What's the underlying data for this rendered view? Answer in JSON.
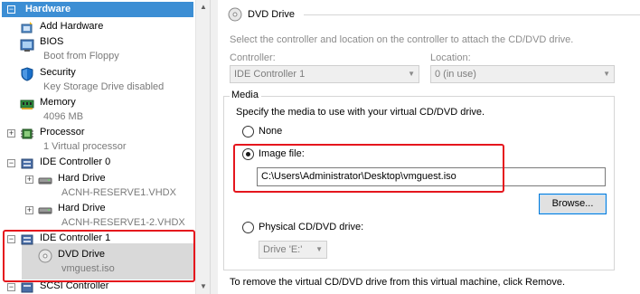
{
  "tree": {
    "header": "Hardware",
    "items": [
      {
        "label": "Add Hardware",
        "sub": ""
      },
      {
        "label": "BIOS",
        "sub": "Boot from Floppy"
      },
      {
        "label": "Security",
        "sub": "Key Storage Drive disabled"
      },
      {
        "label": "Memory",
        "sub": "4096 MB"
      },
      {
        "label": "Processor",
        "sub": "1 Virtual processor"
      },
      {
        "label": "IDE Controller 0",
        "sub": ""
      },
      {
        "label": "Hard Drive",
        "sub": "ACNH-RESERVE1.VHDX"
      },
      {
        "label": "Hard Drive",
        "sub": "ACNH-RESERVE1-2.VHDX"
      },
      {
        "label": "IDE Controller 1",
        "sub": ""
      },
      {
        "label": "DVD Drive",
        "sub": "vmguest.iso"
      },
      {
        "label": "SCSI Controller",
        "sub": ""
      }
    ],
    "expander_plus": "+",
    "expander_minus": "−"
  },
  "panel": {
    "title": "DVD Drive",
    "description": "Select the controller and location on the controller to attach the CD/DVD drive.",
    "controller_label": "Controller:",
    "controller_value": "IDE Controller 1",
    "location_label": "Location:",
    "location_value": "0 (in use)",
    "media_group": "Media",
    "media_description": "Specify the media to use with your virtual CD/DVD drive.",
    "none_label": "None",
    "image_file_label": "Image file:",
    "image_file_value": "C:\\Users\\Administrator\\Desktop\\vmguest.iso",
    "browse_label": "Browse...",
    "physical_label": "Physical CD/DVD drive:",
    "physical_value": "Drive 'E:'",
    "remove_hint": "To remove the virtual CD/DVD drive from this virtual machine, click Remove."
  },
  "colors": {
    "header_blue": "#3c8ed4",
    "highlight_red": "#e5161d",
    "selection_gray": "#d9d9d9"
  }
}
